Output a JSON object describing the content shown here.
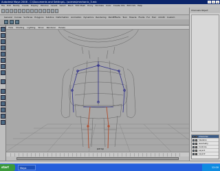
{
  "window": {
    "title": "Autodesk Maya 2008 - C:\\Documents and Settings\\...\\scenes\\mechanic_3.mb",
    "buttons": [
      "_",
      "□",
      "×"
    ]
  },
  "menubar": {
    "items": [
      "File",
      "Edit",
      "Modify",
      "Create",
      "Display",
      "Window",
      "Assets",
      "Select",
      "Mesh",
      "Edit Mesh",
      "Proxy",
      "Normals",
      "Color",
      "Create UVs",
      "Edit UVs",
      "Help"
    ]
  },
  "shelf": {
    "tabs": [
      "General",
      "Curves",
      "Surfaces",
      "Polygons",
      "Subdivs",
      "Deformation",
      "Animation",
      "Dynamics",
      "Rendering",
      "PaintEffects",
      "Toon",
      "Muscle",
      "Fluids",
      "Fur",
      "Hair",
      "nCloth",
      "Custom"
    ]
  },
  "panel": {
    "menu": [
      "View",
      "Shading",
      "Lighting",
      "Show",
      "Renderer",
      "Panels"
    ],
    "camera_label": "persp"
  },
  "channelbox": {
    "header": "Channels  Object"
  },
  "layers": {
    "rows": [
      "Character",
      "Skeleton",
      "Geometry",
      "Controls",
      "Layer1",
      "Layer2"
    ],
    "selected_index": 0
  },
  "taskbar": {
    "start_label": "start",
    "task_label": "Maya",
    "clock": "12:00"
  },
  "colors": {
    "viewport_bg": "#a8a8a8",
    "wireframe": "#5a5a5a",
    "skeleton": "#2c2c8a",
    "leg_bones": "#b04a2a",
    "grid": "#7c7c7c",
    "title_bar": "#0a246a"
  }
}
